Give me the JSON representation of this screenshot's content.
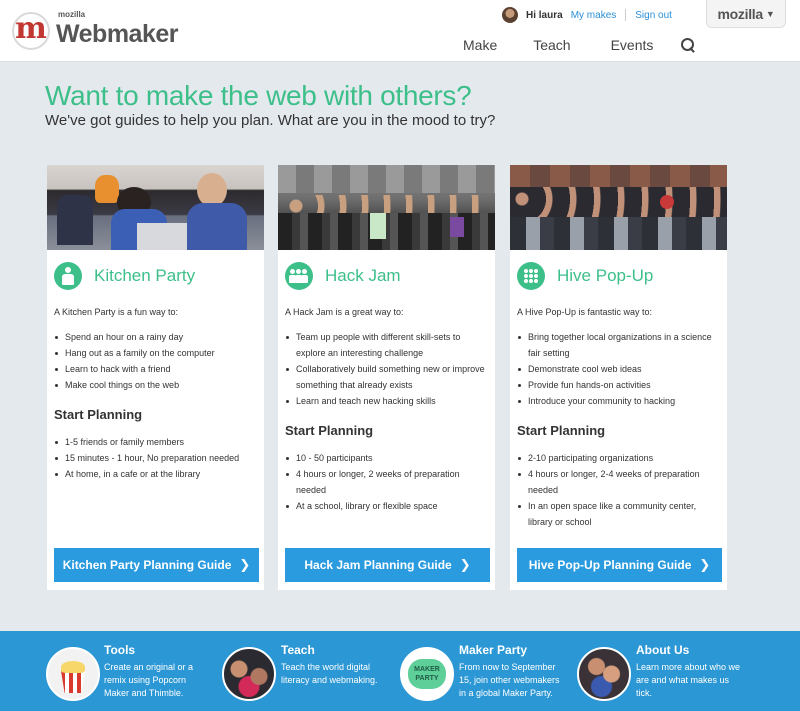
{
  "header": {
    "logo_small": "mozilla",
    "logo_name": "Webmaker",
    "user_greeting": "Hi laura",
    "my_makes": "My makes",
    "sign_out": "Sign out",
    "mozilla_tab": "mozilla",
    "nav": [
      "Make",
      "Teach",
      "Events"
    ]
  },
  "hero": {
    "title": "Want to make the web with others?",
    "subtitle": "We've got guides to help you plan. What are you in the mood to try?"
  },
  "cards": [
    {
      "title": "Kitchen Party",
      "icon": "person-icon",
      "intro": "A Kitchen Party is a fun way to:",
      "items": [
        "Spend an hour on a rainy day",
        "Hang out as a family on the computer",
        "Learn to hack with a friend",
        "Make cool things on the web"
      ],
      "start_title": "Start Planning",
      "plan": [
        "1-5 friends or family members",
        "15 minutes - 1 hour, No preparation needed",
        "At home, in a cafe or at the library"
      ],
      "button": "Kitchen Party Planning Guide"
    },
    {
      "title": "Hack Jam",
      "icon": "group-icon",
      "intro": "A Hack Jam is a great way to:",
      "items": [
        "Team up people with different skill-sets to explore an interesting challenge",
        "Collaboratively build something new or improve something that already exists",
        "Learn and teach new hacking skills"
      ],
      "start_title": "Start Planning",
      "plan": [
        "10 - 50 participants",
        "4 hours or longer, 2 weeks of preparation needed",
        "At a school, library or flexible space"
      ],
      "button": "Hack Jam Planning Guide"
    },
    {
      "title": "Hive Pop-Up",
      "icon": "grid-icon",
      "intro": "A Hive Pop-Up is fantastic way to:",
      "items": [
        "Bring together local organizations in a science fair setting",
        "Demonstrate cool web ideas",
        "Provide fun hands-on activities",
        "Introduce your community to hacking"
      ],
      "start_title": "Start Planning",
      "plan": [
        "2-10 participating organizations",
        "4 hours or longer, 2-4 weeks of preparation needed",
        "In an open space like a community center, library or school"
      ],
      "button": "Hive Pop-Up Planning Guide"
    }
  ],
  "footer": [
    {
      "title": "Tools",
      "text": "Create an original or a remix using Popcorn Maker and Thimble."
    },
    {
      "title": "Teach",
      "text": "Teach the world digital literacy and webmaking."
    },
    {
      "title": "Maker Party",
      "text": "From now to September 15, join other webmakers in a global Maker Party.",
      "badge": "MAKER PARTY"
    },
    {
      "title": "About Us",
      "text": "Learn more about who we are and what makes us tick."
    }
  ],
  "colors": {
    "accent_green": "#3dbf8a",
    "button_blue": "#2b9be0",
    "footer_blue": "#2b97d4",
    "page_bg": "#e4e9ee"
  }
}
